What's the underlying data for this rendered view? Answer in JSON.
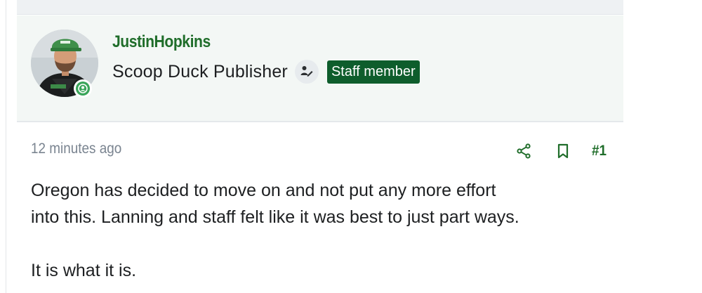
{
  "post": {
    "author": {
      "username": "JustinHopkins",
      "title": "Scoop Duck Publisher",
      "staff_badge": "Staff member",
      "online": true
    },
    "timestamp": "12 minutes ago",
    "post_number": "#1",
    "body": {
      "line1": "Oregon has decided to move on and not put any more effort",
      "line2": "into this. Lanning and staff felt like it was best to just part ways.",
      "line3": "It is what it is."
    },
    "icons": {
      "share": "share-icon",
      "bookmark": "bookmark-icon",
      "badge": "publisher-pen-icon",
      "online": "online-user-icon"
    }
  },
  "colors": {
    "username": "#1f6d2a",
    "staff_badge_bg": "#0e5d2c",
    "meta_text": "#7a8490",
    "author_bg": "#f3f7f5",
    "online": "#3aa55a"
  }
}
